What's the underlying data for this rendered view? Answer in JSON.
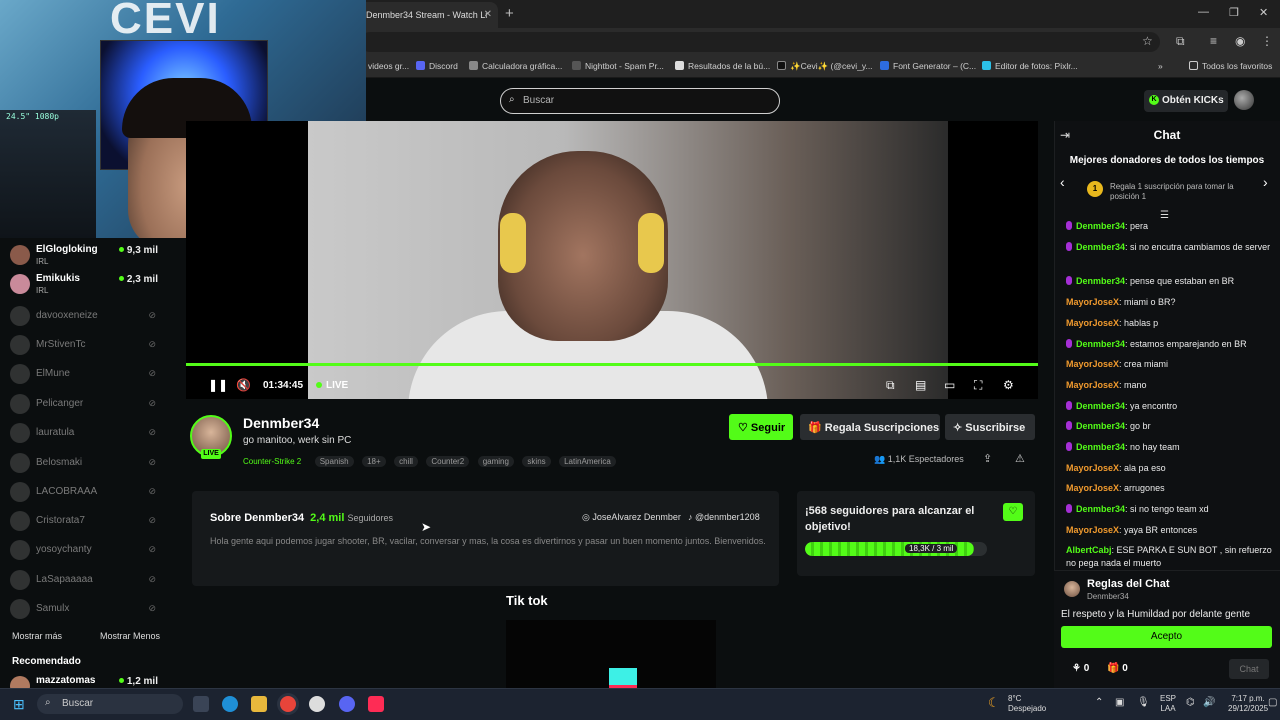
{
  "browser": {
    "tab_title": "Denmber34 Stream - Watch Li",
    "bookmarks": [
      "videos gr...",
      "Discord",
      "Calculadora gráfica...",
      "Nightbot - Spam Pr...",
      "Resultados de la bú...",
      "✨Cevi✨ (@cevi_y...",
      "Font Generator – (C...",
      "Editor de fotos: Pixlr...",
      "Todos los favoritos"
    ]
  },
  "header": {
    "search_placeholder": "Buscar",
    "kicks_button": "Obtén KICKs"
  },
  "sidebar": {
    "live_channels": [
      {
        "name": "ElGlogloking",
        "category": "IRL",
        "viewers": "9,3 mil"
      },
      {
        "name": "Emikukis",
        "category": "IRL",
        "viewers": "2,3 mil"
      }
    ],
    "offline_channels": [
      "davooxeneize",
      "MrStivenTc",
      "ElMune",
      "Pelicanger",
      "lauratula",
      "Belosmaki",
      "LACOBRAAA",
      "Cristorata7",
      "yosoychanty",
      "LaSapaaaaa",
      "Samulx"
    ],
    "show_more": "Mostrar más",
    "show_less": "Mostrar Menos",
    "recommended_title": "Recomendado",
    "recommended": [
      {
        "name": "mazzatomas",
        "viewers": "1,2 mil"
      }
    ]
  },
  "player": {
    "time": "01:34:45",
    "live_label": "LIVE"
  },
  "channel": {
    "name": "Denmber34",
    "stream_title": "go manitoo, werk sin PC",
    "category": "Counter-Strike 2",
    "tags": [
      "Spanish",
      "18+",
      "chill",
      "Counter2",
      "gaming",
      "skins",
      "LatinAmerica"
    ],
    "live_badge": "LIVE",
    "follow_button": "Seguir",
    "gift_button": "Regala Suscripciones",
    "subscribe_button": "Suscribirse",
    "viewers_label": "1,1K Espectadores"
  },
  "about": {
    "title": "Sobre Denmber34",
    "followers": "2,4 mil",
    "followers_label": "Seguidores",
    "social_1": "JoseAlvarez Denmber",
    "social_2": "@denmber1208",
    "description": "Hola gente aqui podemos jugar shooter, BR, vacilar, conversar y mas, la cosa es divertirnos y pasar un buen momento juntos. Bienvenidos."
  },
  "goal": {
    "title": "¡568 seguidores para alcanzar el objetivo!",
    "progress_label": "18,3K / 3 mil",
    "progress_fraction": 0.93
  },
  "tiktok_section": {
    "title": "Tik tok"
  },
  "chat": {
    "title": "Chat",
    "donors_title": "Mejores donadores de todos los tiempos",
    "donor_prompt": "Regala 1 suscripción para tomar la posición 1",
    "donor_rank": "1",
    "messages": [
      {
        "user": "Denmber34",
        "text": "pera",
        "badge": true,
        "color": "den"
      },
      {
        "user": "Denmber34",
        "text": "si no encutra cambiamos de server",
        "badge": true,
        "color": "den"
      },
      {
        "user": "Denmber34",
        "text": "pense que estaban en BR",
        "badge": true,
        "color": "den"
      },
      {
        "user": "MayorJoseX",
        "text": "miami o BR?",
        "badge": false,
        "color": "may"
      },
      {
        "user": "MayorJoseX",
        "text": "hablas p",
        "badge": false,
        "color": "may"
      },
      {
        "user": "Denmber34",
        "text": "estamos emparejando en BR",
        "badge": true,
        "color": "den"
      },
      {
        "user": "MayorJoseX",
        "text": "crea miami",
        "badge": false,
        "color": "may"
      },
      {
        "user": "MayorJoseX",
        "text": "mano",
        "badge": false,
        "color": "may"
      },
      {
        "user": "Denmber34",
        "text": "ya encontro",
        "badge": true,
        "color": "den"
      },
      {
        "user": "Denmber34",
        "text": "go br",
        "badge": true,
        "color": "den"
      },
      {
        "user": "Denmber34",
        "text": "no hay team",
        "badge": true,
        "color": "den"
      },
      {
        "user": "MayorJoseX",
        "text": "ala pa eso",
        "badge": false,
        "color": "may"
      },
      {
        "user": "MayorJoseX",
        "text": "arrugones",
        "badge": false,
        "color": "may"
      },
      {
        "user": "Denmber34",
        "text": "si no tengo team xd",
        "badge": true,
        "color": "den"
      },
      {
        "user": "MayorJoseX",
        "text": "yaya BR entonces",
        "badge": false,
        "color": "may"
      },
      {
        "user": "AlbertCabj",
        "text": "ESE PARKA E SUN BOT , sin refuerzo no pega nada el muerto",
        "badge": false,
        "color": "alb"
      }
    ],
    "rules_title": "Reglas del Chat",
    "rules_channel": "Denmber34",
    "rules_message": "El respeto y la Humildad por delante gente",
    "accept_button": "Acepto",
    "points_count": "0",
    "gifts_count": "0",
    "send_button": "Chat"
  },
  "taskbar": {
    "search": "Buscar",
    "weather_temp": "8°C",
    "weather_desc": "Despejado",
    "lang_1": "ESP",
    "lang_2": "LAA",
    "time": "7:17 p.m.",
    "date": "29/12/2025"
  },
  "webcam": {
    "overlay_text": "CEVI",
    "monitor_text": "24.5\" 1080p"
  }
}
